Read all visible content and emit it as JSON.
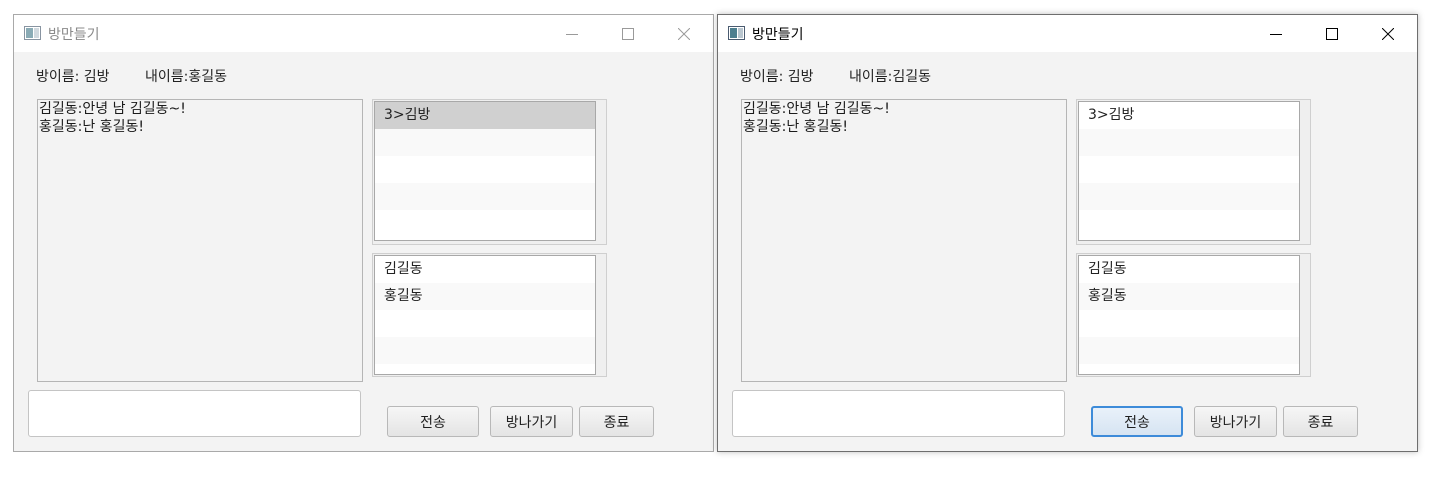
{
  "windows": [
    {
      "title": "방만들기",
      "room_info": "방이름: 김방",
      "my_name": "내이름:홍길동",
      "chat_lines": [
        "김길동:안녕 남 김길동~!",
        "홍길동:난 홍길동!"
      ],
      "rooms": [
        "3>김방",
        "",
        "",
        "",
        ""
      ],
      "users": [
        "김길동",
        "홍길동",
        "",
        "",
        ""
      ],
      "message_value": "",
      "buttons": {
        "send": "전송",
        "leave": "방나가기",
        "exit": "종료"
      },
      "active": false
    },
    {
      "title": "방만들기",
      "room_info": "방이름: 김방",
      "my_name": "내이름:김길동",
      "chat_lines": [
        "김길동:안녕 남 김길동~!",
        "홍길동:난 홍길동!"
      ],
      "rooms": [
        "3>김방",
        "",
        "",
        "",
        ""
      ],
      "users": [
        "김길동",
        "홍길동",
        "",
        "",
        ""
      ],
      "message_value": "",
      "buttons": {
        "send": "전송",
        "leave": "방나가기",
        "exit": "종료"
      },
      "active": true
    }
  ],
  "icons": {
    "app": "window-app-icon",
    "minimize": "minimize-icon",
    "maximize": "maximize-icon",
    "close": "close-icon"
  },
  "colors": {
    "focus_border": "#3d8bd9",
    "selected_row": "#d0d0d0",
    "window_bg": "#f3f3f3"
  }
}
